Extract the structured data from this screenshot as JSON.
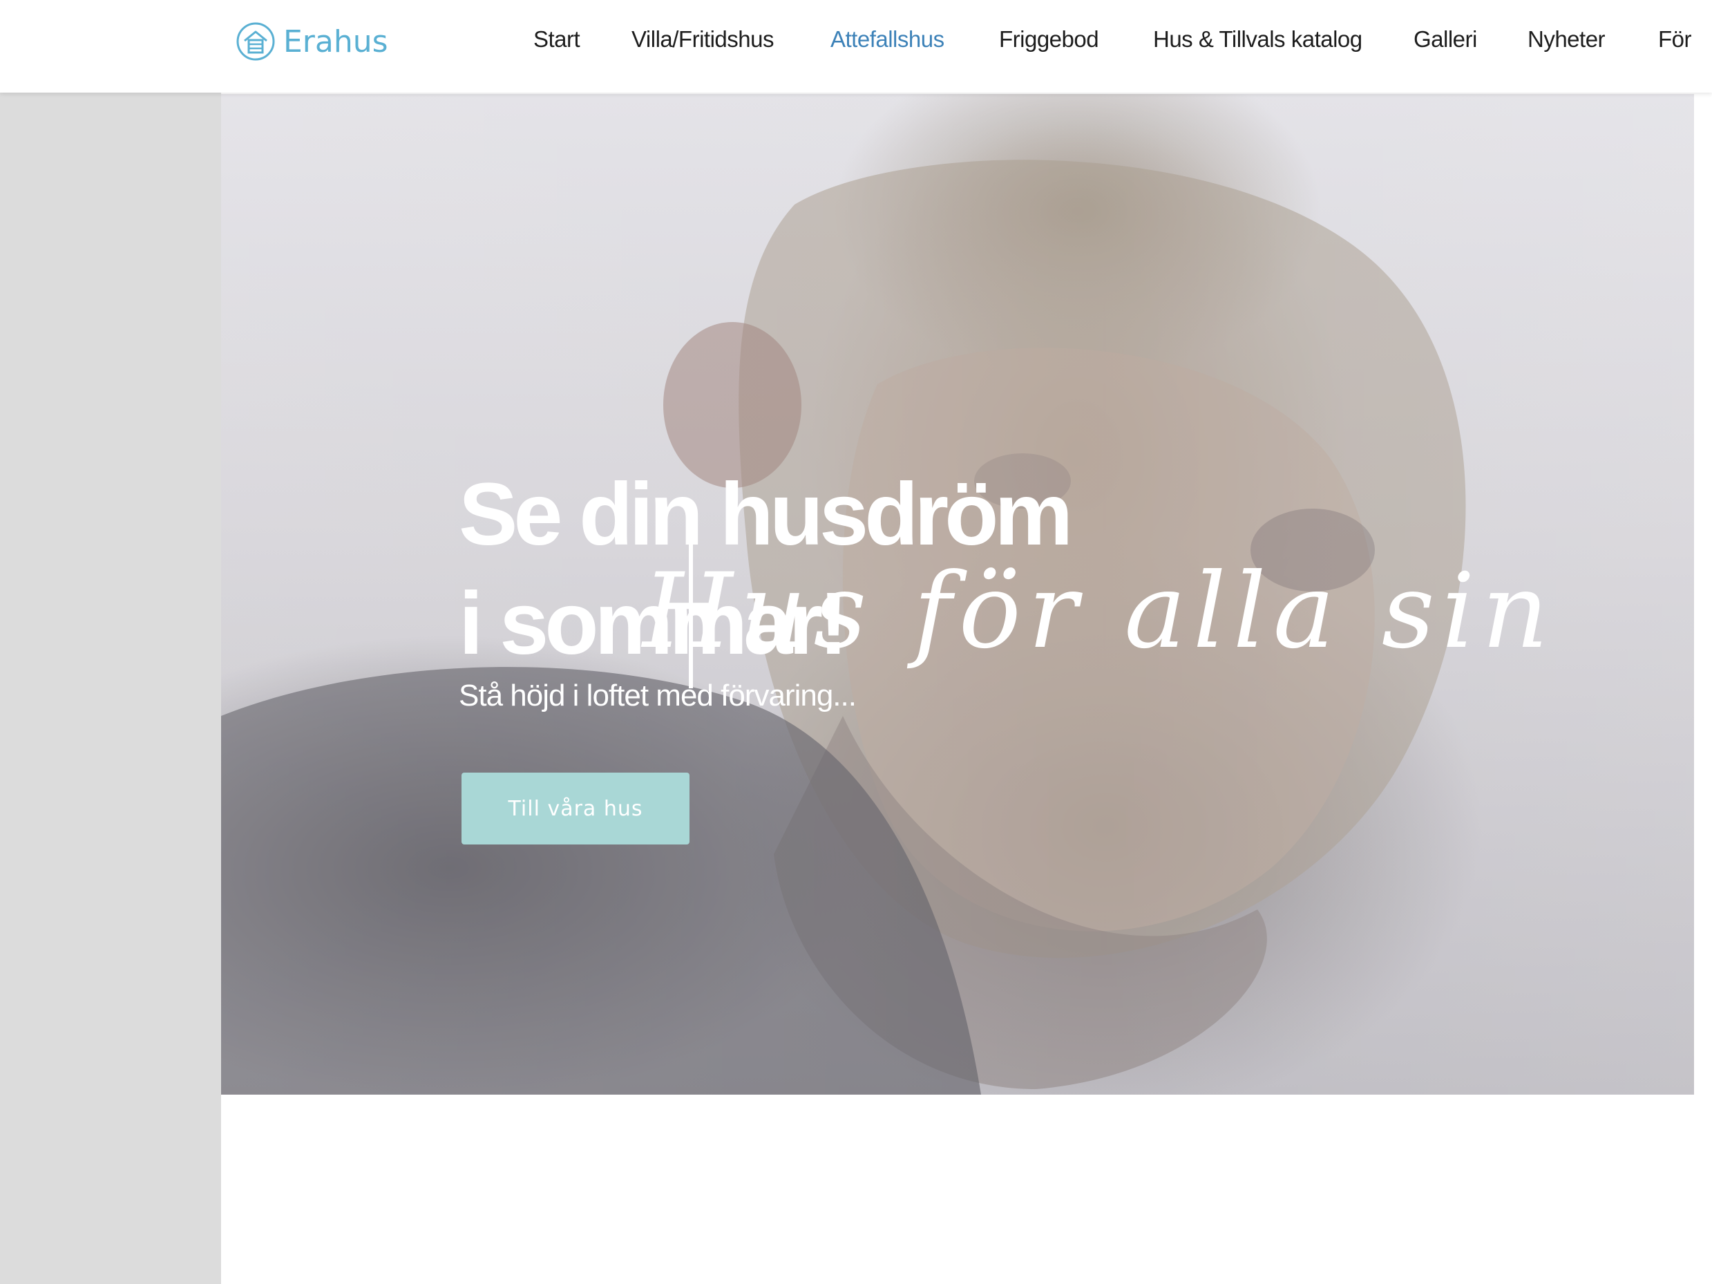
{
  "brand": {
    "name": "Erahus",
    "color": "#5ab0d3"
  },
  "nav": {
    "items": [
      {
        "label": "Start",
        "active": false
      },
      {
        "label": "Villa/Fritidshus",
        "active": false
      },
      {
        "label": "Attefallshus",
        "active": true
      },
      {
        "label": "Friggebod",
        "active": false
      },
      {
        "label": "Hus & Tillvals katalog",
        "active": false
      },
      {
        "label": "Galleri",
        "active": false
      },
      {
        "label": "Nyheter",
        "active": false
      },
      {
        "label": "För",
        "active": false
      }
    ],
    "active_color": "#3d82b8"
  },
  "hero": {
    "title_line1": "Se din husdröm",
    "title_line2": "i sommar!",
    "subtitle": "Stå höjd i loftet med förvaring...",
    "script_overlay": "Hus för alla sin",
    "button_label": "Till våra hus",
    "button_color": "#a9d7d6"
  },
  "icons": {
    "logo": "house-circle-icon"
  }
}
